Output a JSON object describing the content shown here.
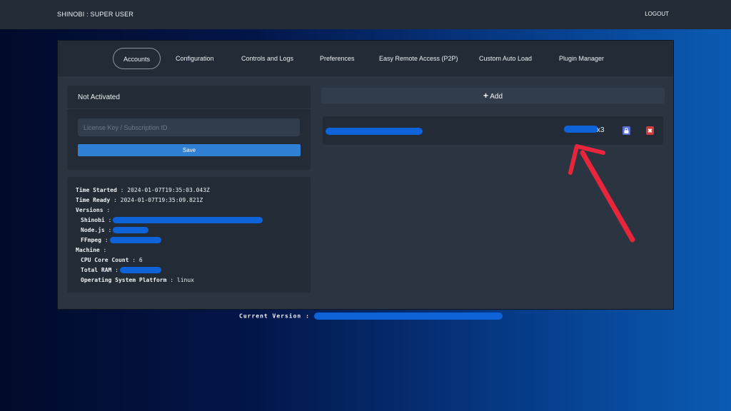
{
  "header": {
    "brand": "SHINOBI : SUPER USER",
    "logout_label": "LOGOUT"
  },
  "tabs": [
    {
      "label": "Accounts",
      "active": true
    },
    {
      "label": "Configuration",
      "active": false
    },
    {
      "label": "Controls and Logs",
      "active": false
    },
    {
      "label": "Preferences",
      "active": false
    },
    {
      "label": "Easy Remote Access (P2P)",
      "active": false
    },
    {
      "label": "Custom Auto Load",
      "active": false
    },
    {
      "label": "Plugin Manager",
      "active": false
    }
  ],
  "license": {
    "title": "Not Activated",
    "input_placeholder": "License Key / Subscription ID",
    "input_value": "",
    "save_label": "Save"
  },
  "info": {
    "time_started_label": "Time Started",
    "time_started_value": "2024-01-07T19:35:03.043Z",
    "time_ready_label": "Time Ready",
    "time_ready_value": "2024-01-07T19:35:09.821Z",
    "versions_label": "Versions",
    "shinobi_label": "Shinobi",
    "nodejs_label": "Node.js",
    "ffmpeg_label": "FFmpeg",
    "machine_label": "Machine",
    "cpu_label": "CPU Core Count",
    "cpu_value": "6",
    "ram_label": "Total RAM",
    "os_label": "Operating System Platform",
    "os_value": "linux",
    "separator": " : "
  },
  "accounts": {
    "add_label": "Add",
    "add_icon": "plus-icon",
    "rows": [
      {
        "id_suffix": "x3",
        "lock_icon": "lock-icon",
        "delete_icon": "close-icon"
      }
    ]
  },
  "footer": {
    "current_version_label": "Current Version :"
  },
  "colors": {
    "accent": "#2f7fd4",
    "redaction": "#0f63d8",
    "lock_button": "#5a6fd6",
    "delete_button": "#d23b3b",
    "annotation_arrow": "#e8253b"
  }
}
